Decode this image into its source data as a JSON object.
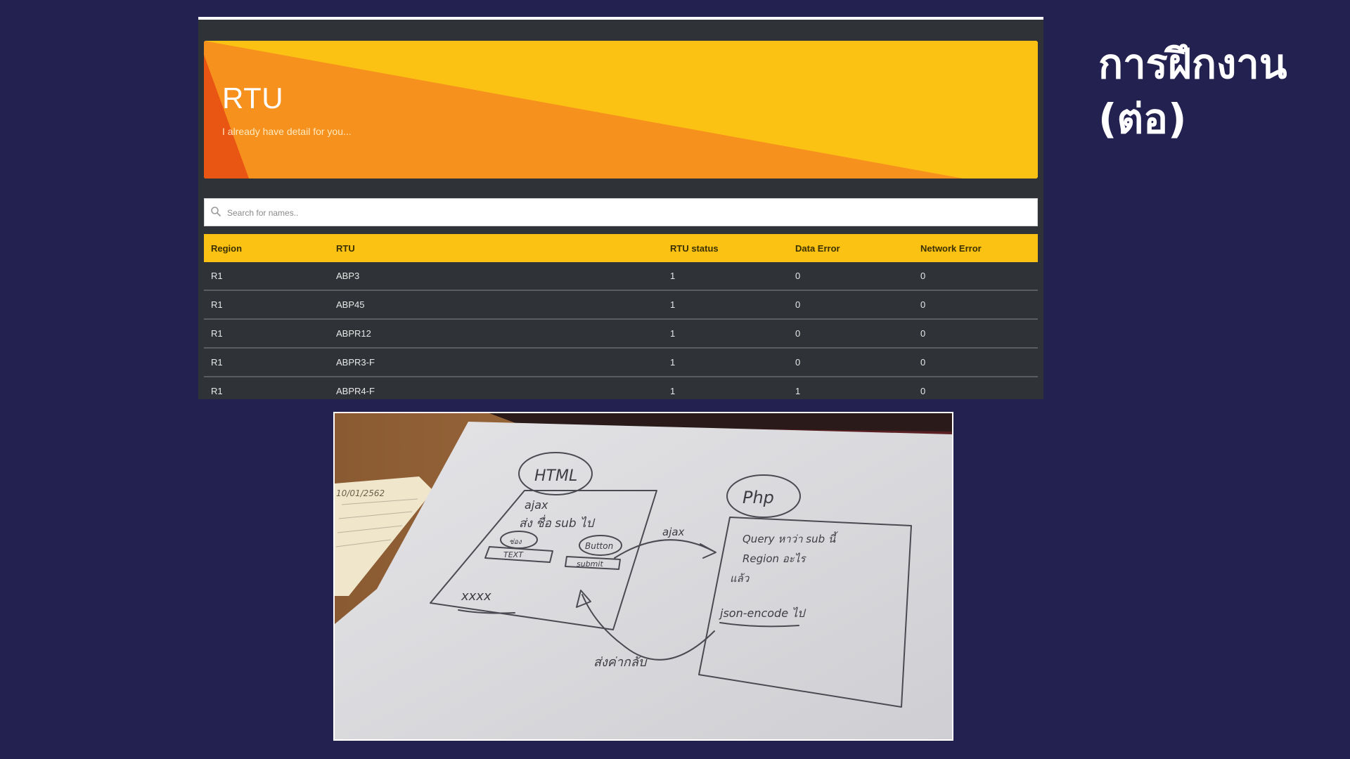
{
  "heading": {
    "line1": "การฝึกงาน",
    "line2": "(ต่อ)"
  },
  "app": {
    "title": "RTU",
    "subtitle": "I already have detail for you...",
    "search": {
      "placeholder": "Search for names..",
      "icon": "search-icon"
    },
    "table": {
      "headers": [
        "Region",
        "RTU",
        "RTU status",
        "Data Error",
        "Network Error"
      ],
      "rows": [
        [
          "R1",
          "ABP3",
          "1",
          "0",
          "0"
        ],
        [
          "R1",
          "ABP45",
          "1",
          "0",
          "0"
        ],
        [
          "R1",
          "ABPR12",
          "1",
          "0",
          "0"
        ],
        [
          "R1",
          "ABPR3-F",
          "1",
          "0",
          "0"
        ],
        [
          "R1",
          "ABPR4-F",
          "1",
          "1",
          "0"
        ]
      ]
    },
    "colors": {
      "banner": "#fbc113",
      "accent": "#f7911e",
      "deep": "#e95513",
      "background": "#23214f"
    }
  },
  "sketch": {
    "date": "10/01/2562",
    "html_label": "HTML",
    "php_label": "Php",
    "left_box": {
      "line1": "ajax",
      "line2": "ส่ง ชื่อ sub ไป",
      "circle1": "ช่อง",
      "box1": "TEXT",
      "circle2": "Button",
      "box2": "submit",
      "marks": "xxxx"
    },
    "arrow_label": "ajax",
    "right_box": {
      "line1": "Query หาว่า sub นี้",
      "line2": "Region อะไร",
      "line3": "แล้ว",
      "line4": "json-encode ไป"
    },
    "return_label": "ส่งค่ากลับ"
  }
}
